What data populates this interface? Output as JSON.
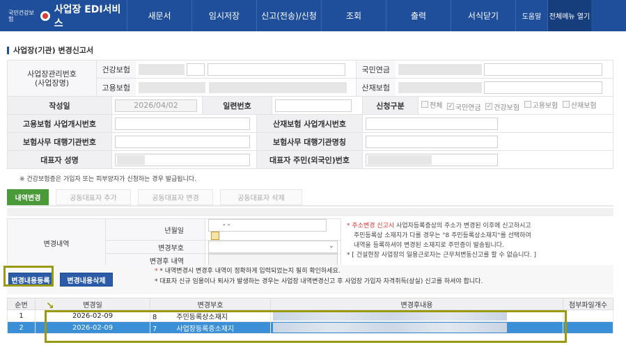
{
  "header": {
    "brand_small": "국민건강보험",
    "service_name": "사업장 EDI서비스",
    "menu": [
      "새문서",
      "임시저장",
      "신고(전송)/신청",
      "조회",
      "출력",
      "서식닫기"
    ],
    "help": "도움말",
    "all_menu": "전체메뉴 열기"
  },
  "page": {
    "title": "사업장(기관) 변경신고서"
  },
  "form": {
    "mgmt_no_label": "사업장관리번호\n(사업장명)",
    "health_label": "건강보험",
    "employment_label": "고용보험",
    "pension_label": "국민연금",
    "accident_label": "산재보험",
    "created_label": "작성일",
    "created_value": "2026/04/02",
    "serial_label": "일련번호",
    "report_type_label": "신청구분",
    "report_types": [
      {
        "label": "전체",
        "checked": false
      },
      {
        "label": "국민연금",
        "checked": true
      },
      {
        "label": "건강보험",
        "checked": true
      },
      {
        "label": "고용보험",
        "checked": false
      },
      {
        "label": "산재보험",
        "checked": false
      }
    ],
    "emp_open_label": "고용보험 사업개시번호",
    "acc_open_label": "산재보험 사업개시번호",
    "agency_no_label": "보험사무 대행기관번호",
    "agency_name_label": "보험사무 대행기관명칭",
    "rep_name_label": "대표자 성명",
    "rep_id_label": "대표자 주민(외국인)번호"
  },
  "note_health": "※ 건강보험증은 가입자 또는 피부양자가 신청하는 경우 발급됩니다.",
  "tabs": [
    "내역변경",
    "공동대표자 추가",
    "공동대표자 변경",
    "공동대표자 삭제"
  ],
  "change": {
    "section_label": "변경내역",
    "date_label": "년월일",
    "date_value": "-  -",
    "code_label": "변경부호",
    "after_label": "변경후 내역",
    "notes": [
      {
        "prefix": "* 주소변경 신고시",
        "text": " 사업자등록증상의 주소가 변경된 이후에 신고하시고"
      },
      {
        "prefix": "",
        "text": "주민등록상 소재지가 다를 경우는 \"8 주민등록상소재지\"를 선택하여"
      },
      {
        "prefix": "",
        "text": "내역을 등록하셔야 변경된 소재지로 주민증이 발송됩니다."
      },
      {
        "prefix": "",
        "text": "* [ 건설현장 사업장의 일용근로자는 근무처변동신고를 할 수 없습니다. ]"
      }
    ]
  },
  "buttons": {
    "register": "변경내용등록",
    "delete": "변경내용삭제"
  },
  "notes_btn": [
    "* 내역변경시 변경후 내역이 정확하게 입력되었는지 필히 확인하세요.",
    "* 대표자 신규 임용이나 퇴사가 발생하는 경우는 사업장 내역변경신고 후 사업장 가입자 자격취득(상실) 신고를 하셔야 합니다."
  ],
  "grid": {
    "headers": [
      "순번",
      "변경일",
      "변경부호",
      "변경후내용",
      "첨부파일개수"
    ],
    "rows": [
      {
        "no": "1",
        "date": "2026-02-09",
        "code": "8",
        "code_name": "주민등록상소재지",
        "selected": false
      },
      {
        "no": "2",
        "date": "2026-02-09",
        "code": "7",
        "code_name": "사업장등록증소재지",
        "selected": true
      }
    ]
  },
  "colors": {
    "header_bg": "#1f4f9a",
    "tab_active": "#4a9a3a",
    "button": "#2c5ca8",
    "highlight": "#9a9a12",
    "row_selected": "#3a8fd6"
  }
}
